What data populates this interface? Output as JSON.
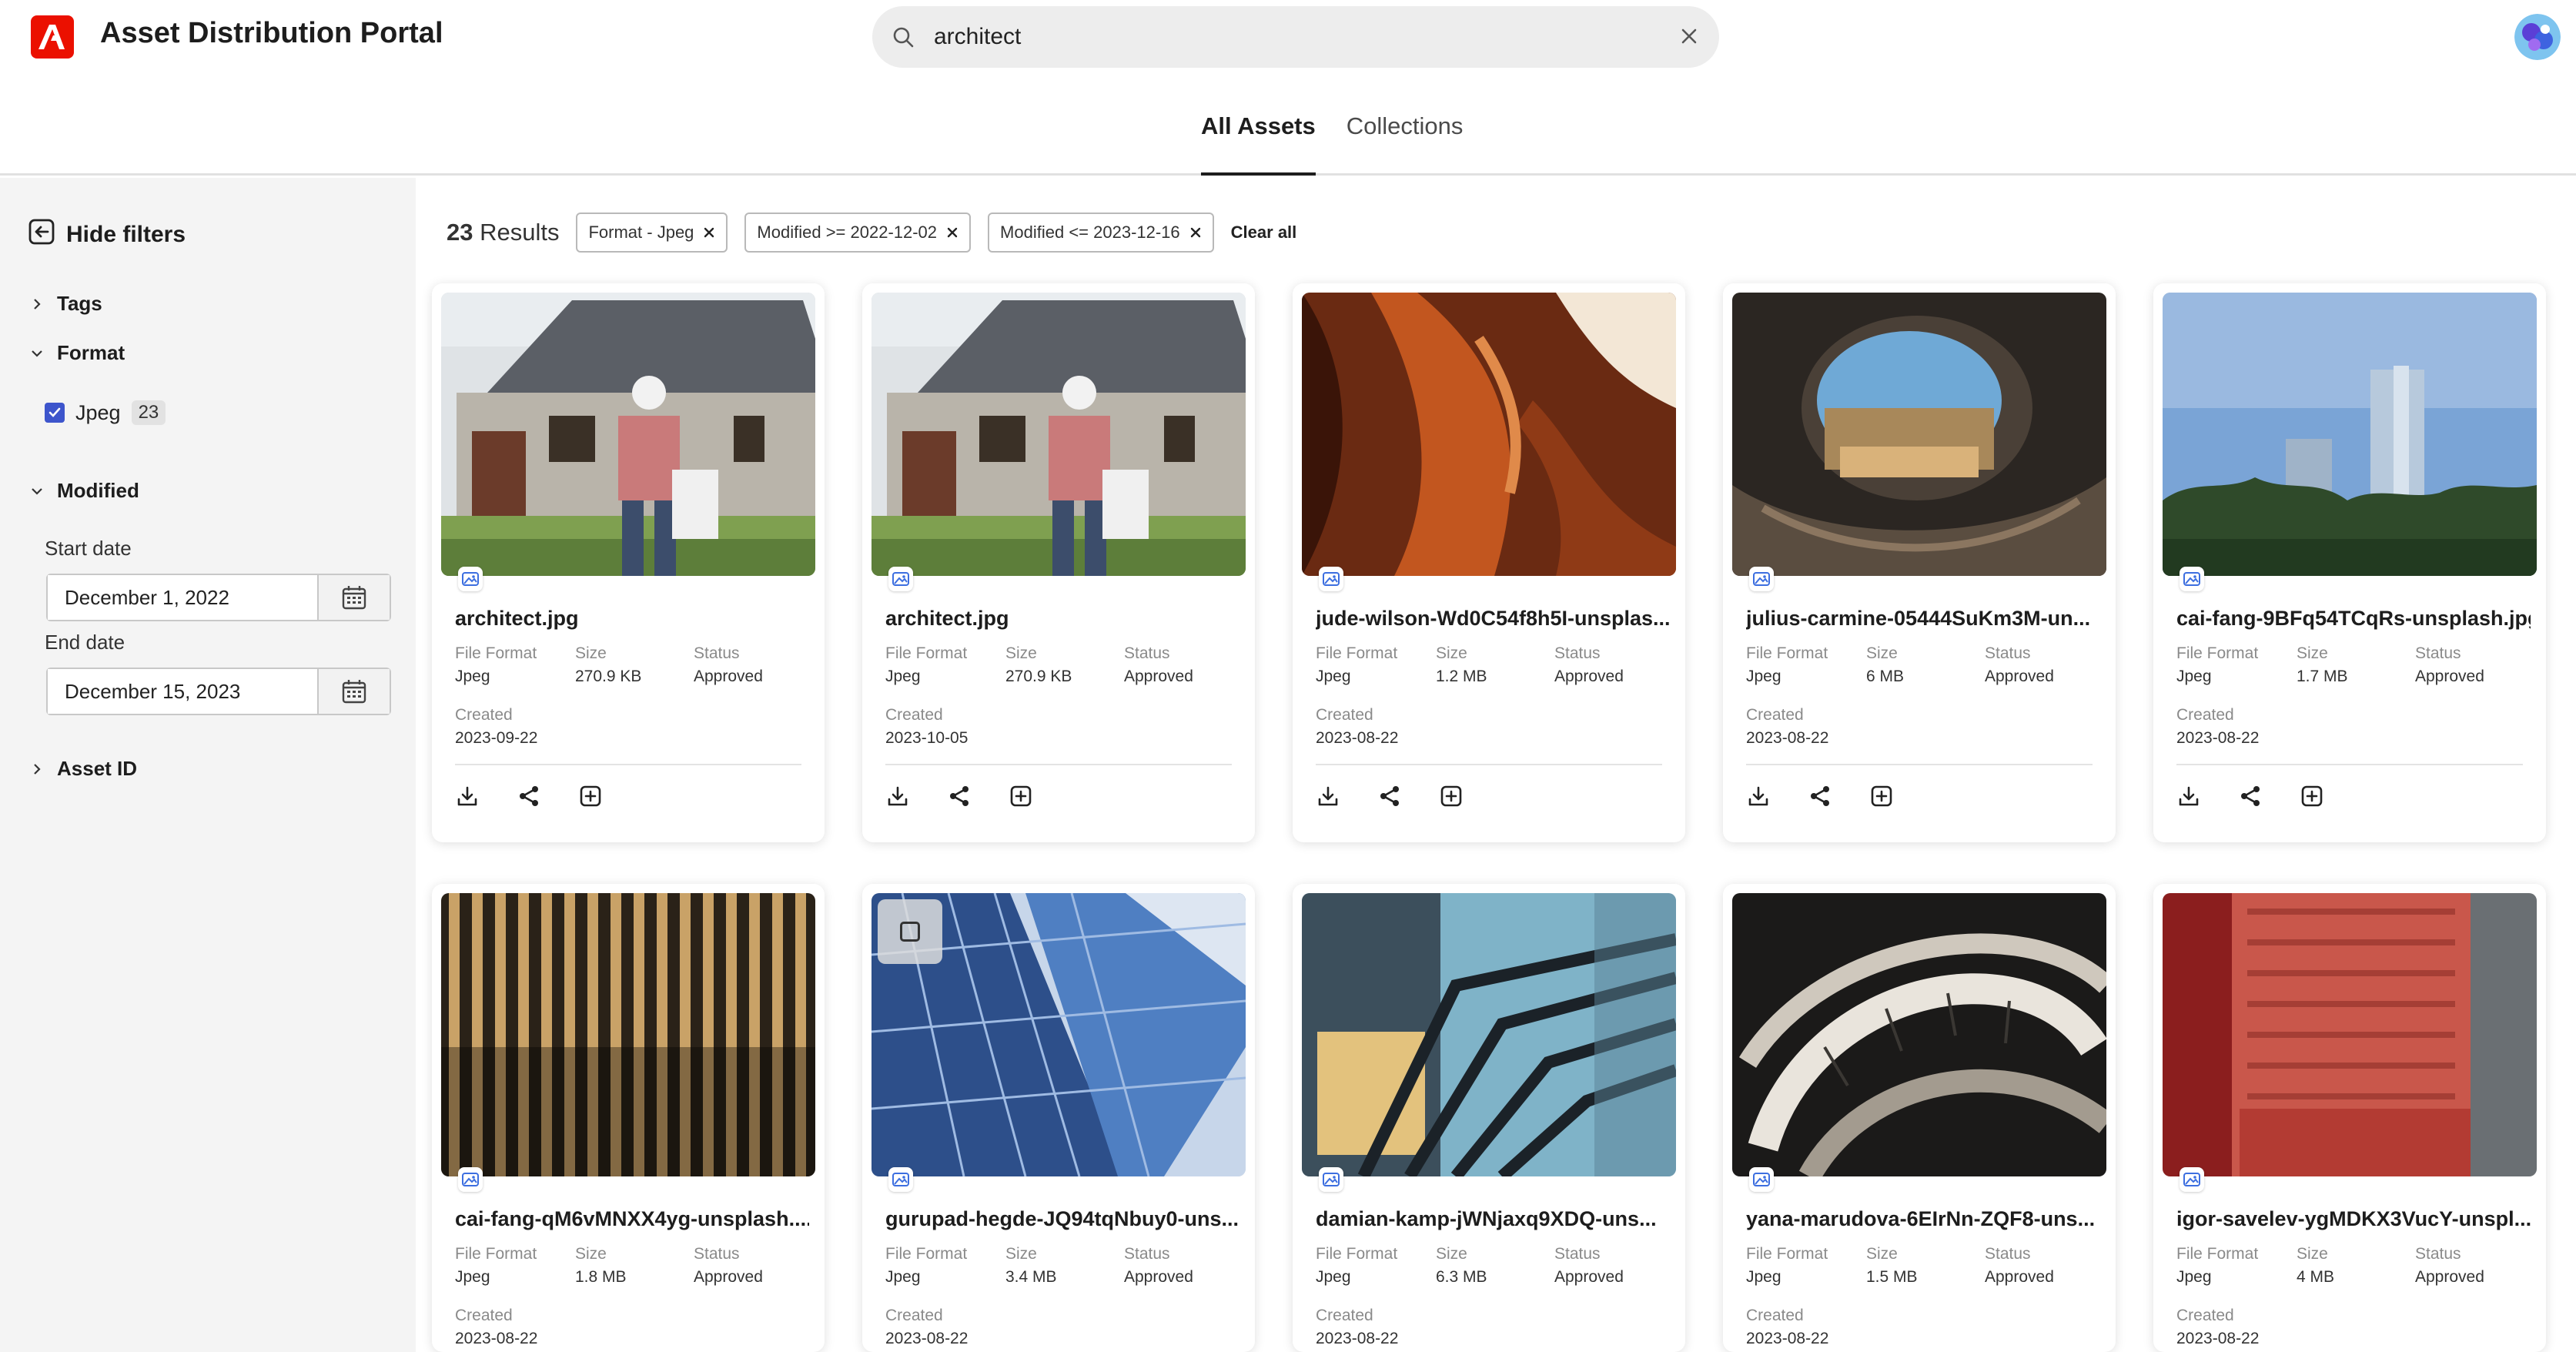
{
  "header": {
    "app_title": "Asset Distribution Portal",
    "search_value": "architect",
    "tabs": [
      {
        "label": "All Assets",
        "active": true
      },
      {
        "label": "Collections",
        "active": false
      }
    ]
  },
  "sidebar": {
    "hide_filters_label": "Hide filters",
    "facets": {
      "tags": "Tags",
      "format": "Format",
      "modified": "Modified",
      "asset_id": "Asset ID"
    },
    "format_option": {
      "label": "Jpeg",
      "count": "23",
      "checked": true
    },
    "start_date_label": "Start date",
    "start_date_value": "December 1, 2022",
    "end_date_label": "End date",
    "end_date_value": "December 15, 2023"
  },
  "results": {
    "count": "23",
    "count_label": "Results",
    "chips": [
      "Format - Jpeg",
      "Modified >= 2022-12-02",
      "Modified <= 2023-12-16"
    ],
    "clear_all": "Clear all"
  },
  "labels": {
    "file_format": "File Format",
    "size": "Size",
    "status": "Status",
    "created": "Created"
  },
  "assets": [
    {
      "title": "architect.jpg",
      "format": "Jpeg",
      "size": "270.9 KB",
      "status": "Approved",
      "created": "2023-09-22",
      "image": "house-architect"
    },
    {
      "title": "architect.jpg",
      "format": "Jpeg",
      "size": "270.9 KB",
      "status": "Approved",
      "created": "2023-10-05",
      "image": "house-architect"
    },
    {
      "title": "jude-wilson-Wd0C54f8h5I-unsplas...",
      "format": "Jpeg",
      "size": "1.2 MB",
      "status": "Approved",
      "created": "2023-08-22",
      "image": "canyon-rock"
    },
    {
      "title": "julius-carmine-05444SuKm3M-un...",
      "format": "Jpeg",
      "size": "6 MB",
      "status": "Approved",
      "created": "2023-08-22",
      "image": "cave-opening"
    },
    {
      "title": "cai-fang-9BFq54TCqRs-unsplash.jpg",
      "format": "Jpeg",
      "size": "1.7 MB",
      "status": "Approved",
      "created": "2023-08-22",
      "image": "skyscrapers-trees"
    },
    {
      "title": "cai-fang-qM6vMNXX4yg-unsplash....",
      "format": "Jpeg",
      "size": "1.8 MB",
      "status": "Approved",
      "created": "2023-08-22",
      "image": "wood-slats"
    },
    {
      "title": "gurupad-hegde-JQ94tqNbuy0-uns...",
      "format": "Jpeg",
      "size": "3.4 MB",
      "status": "Approved",
      "created": "2023-08-22",
      "image": "glass-tower"
    },
    {
      "title": "damian-kamp-jWNjaxq9XDQ-uns...",
      "format": "Jpeg",
      "size": "6.3 MB",
      "status": "Approved",
      "created": "2023-08-22",
      "image": "steel-frame-building"
    },
    {
      "title": "yana-marudova-6EIrNn-ZQF8-uns...",
      "format": "Jpeg",
      "size": "1.5 MB",
      "status": "Approved",
      "created": "2023-08-22",
      "image": "spiral-staircase"
    },
    {
      "title": "igor-savelev-ygMDKX3VucY-unspl...",
      "format": "Jpeg",
      "size": "4 MB",
      "status": "Approved",
      "created": "2023-08-22",
      "image": "red-brick-tower"
    }
  ]
}
